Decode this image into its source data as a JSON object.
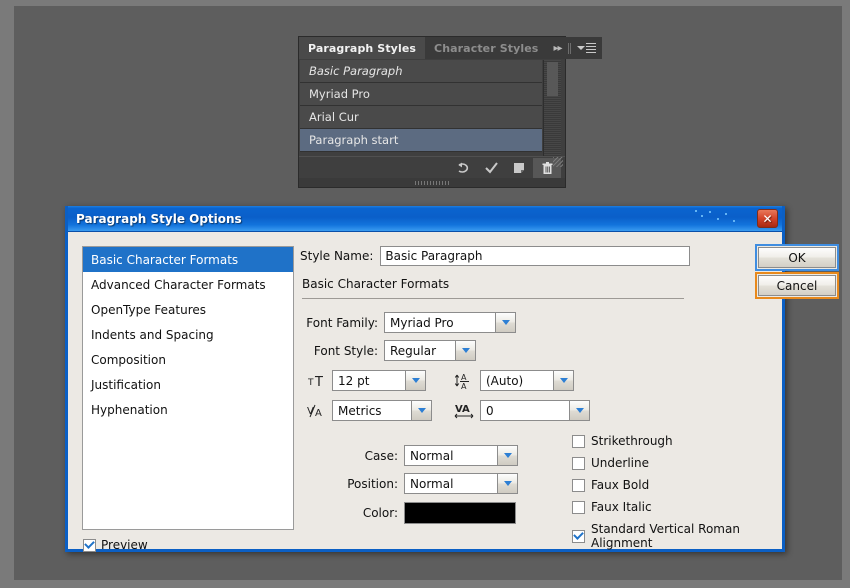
{
  "app": {
    "background_color": "#5e5e5e"
  },
  "styles_panel": {
    "tabs": [
      {
        "label": "Paragraph Styles",
        "active": true
      },
      {
        "label": "Character Styles",
        "active": false
      }
    ],
    "expand_icon": "double-chevron-right-icon",
    "menu_icon": "panel-menu-icon",
    "styles": [
      {
        "name": "Basic Paragraph",
        "italic": true,
        "selected": false
      },
      {
        "name": "Myriad Pro",
        "italic": false,
        "selected": false
      },
      {
        "name": "Arial Cur",
        "italic": false,
        "selected": false
      },
      {
        "name": "Paragraph start",
        "italic": false,
        "selected": true
      }
    ],
    "footer_buttons": [
      {
        "icon": "clear-override-icon",
        "glyph": "↺",
        "highlighted": false
      },
      {
        "icon": "apply-check-icon",
        "glyph": "✓",
        "highlighted": false
      },
      {
        "icon": "new-style-icon",
        "glyph": "❑",
        "highlighted": false
      },
      {
        "icon": "delete-trash-icon",
        "glyph": "🗑",
        "highlighted": true
      }
    ]
  },
  "dialog": {
    "title": "Paragraph Style Options",
    "close_icon": "close-window-icon",
    "categories": [
      {
        "label": "Basic Character Formats",
        "selected": true
      },
      {
        "label": "Advanced Character Formats",
        "selected": false
      },
      {
        "label": "OpenType Features",
        "selected": false
      },
      {
        "label": "Indents and Spacing",
        "selected": false
      },
      {
        "label": "Composition",
        "selected": false
      },
      {
        "label": "Justification",
        "selected": false
      },
      {
        "label": "Hyphenation",
        "selected": false
      }
    ],
    "preview": {
      "label": "Preview",
      "checked": true
    },
    "style_name": {
      "label": "Style Name:",
      "value": "Basic Paragraph",
      "placeholder": "Style Name"
    },
    "section_heading": "Basic Character Formats",
    "buttons": {
      "ok": "OK",
      "cancel": "Cancel"
    },
    "fields": {
      "font_family": {
        "label": "Font Family:",
        "value": "Myriad Pro"
      },
      "font_style": {
        "label": "Font Style:",
        "value": "Regular"
      },
      "size": {
        "icon": "font-size-icon",
        "value": "12 pt"
      },
      "leading": {
        "icon": "leading-icon",
        "value": "(Auto)"
      },
      "kerning": {
        "icon": "kerning-icon",
        "value": "Metrics"
      },
      "tracking": {
        "icon": "tracking-icon",
        "value": "0"
      },
      "case": {
        "label": "Case:",
        "value": "Normal"
      },
      "position": {
        "label": "Position:",
        "value": "Normal"
      },
      "color": {
        "label": "Color:",
        "value": "#000000"
      }
    },
    "checkboxes": [
      {
        "label": "Strikethrough",
        "checked": false
      },
      {
        "label": "Underline",
        "checked": false
      },
      {
        "label": "Faux Bold",
        "checked": false
      },
      {
        "label": "Faux Italic",
        "checked": false
      },
      {
        "label": "Standard Vertical Roman Alignment",
        "checked": true
      }
    ]
  }
}
